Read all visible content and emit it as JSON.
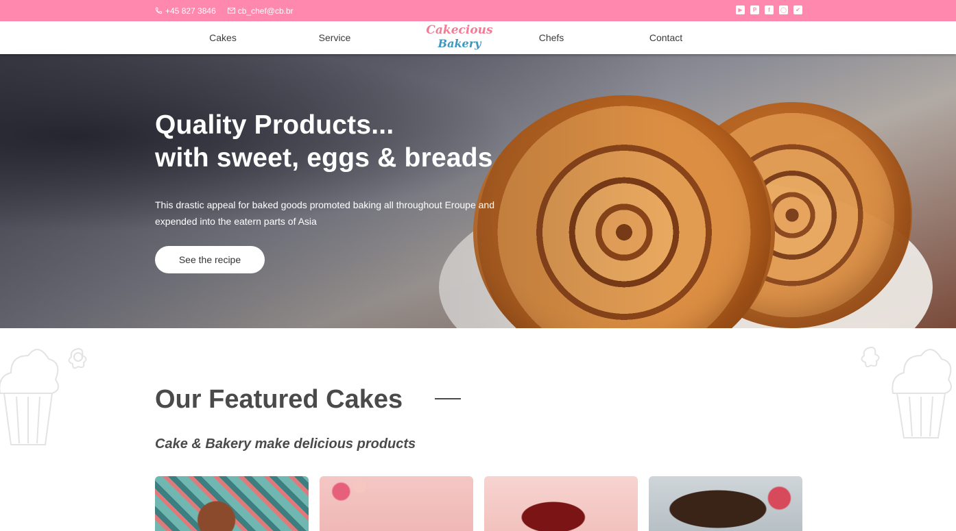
{
  "topbar": {
    "phone": "+45 827 3846",
    "email": "cb_chef@cb.br",
    "social": [
      {
        "icon": "youtube-icon"
      },
      {
        "icon": "pinterest-icon"
      },
      {
        "icon": "facebook-icon"
      },
      {
        "icon": "instagram-icon"
      },
      {
        "icon": "twitter-icon"
      }
    ],
    "background": "#ff88ae"
  },
  "nav": {
    "items": [
      "Cakes",
      "Service",
      "Chefs",
      "Contact"
    ],
    "logo_line1": "Cakecious",
    "logo_line2": "Bakery"
  },
  "hero": {
    "title_line1": "Quality Products...",
    "title_line2": "with sweet, eggs & breads",
    "description": "This drastic appeal for baked goods promoted baking all throughout Eroupe and expended into the eatern parts of Asia",
    "button": "See the recipe"
  },
  "featured": {
    "title": "Our Featured Cakes",
    "subtitle": "Cake & Bakery make delicious products",
    "cards": [
      "cake-image-1",
      "cake-image-2",
      "cake-image-3",
      "cake-image-4"
    ]
  }
}
